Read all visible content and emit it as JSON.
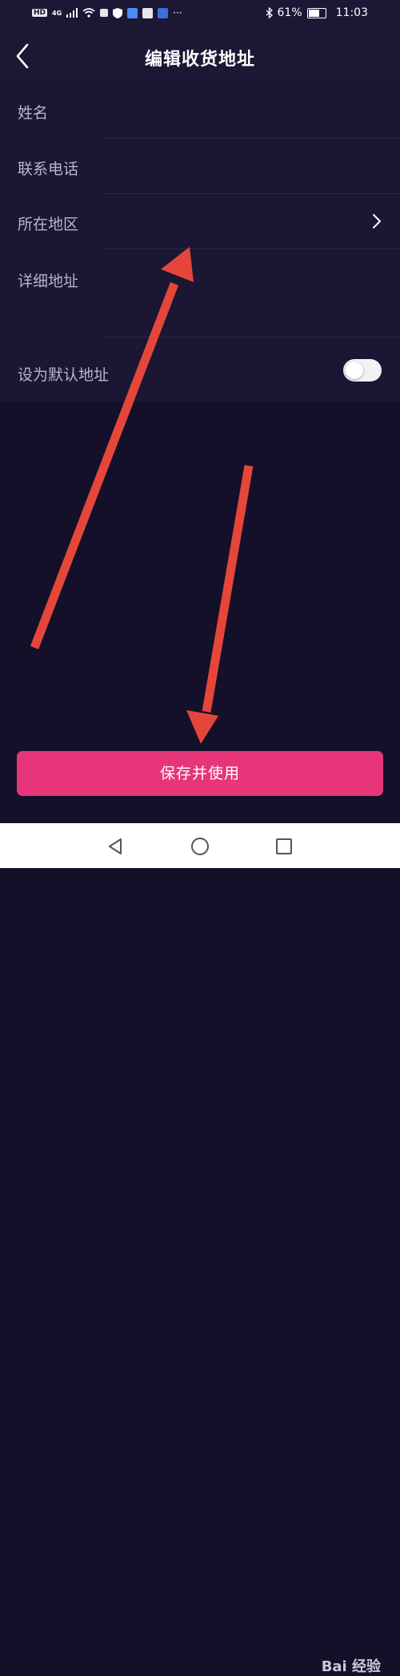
{
  "status_bar": {
    "left_badges": [
      "HD",
      "4G"
    ],
    "more_indicator": "···",
    "battery": "61%",
    "time": "11:03"
  },
  "header": {
    "title": "编辑收货地址"
  },
  "form": {
    "fields": [
      {
        "label": "姓名"
      },
      {
        "label": "联系电话"
      },
      {
        "label": "所在地区"
      },
      {
        "label": "详细地址"
      }
    ],
    "default_toggle": {
      "label": "设为默认地址",
      "on": false
    }
  },
  "actions": {
    "save_label": "保存并使用"
  },
  "watermark": {
    "text": "Bai 经验"
  },
  "colors": {
    "background": "#14102a",
    "panel": "#1a1634",
    "accent": "#e63579",
    "arrow": "#e5463a"
  }
}
